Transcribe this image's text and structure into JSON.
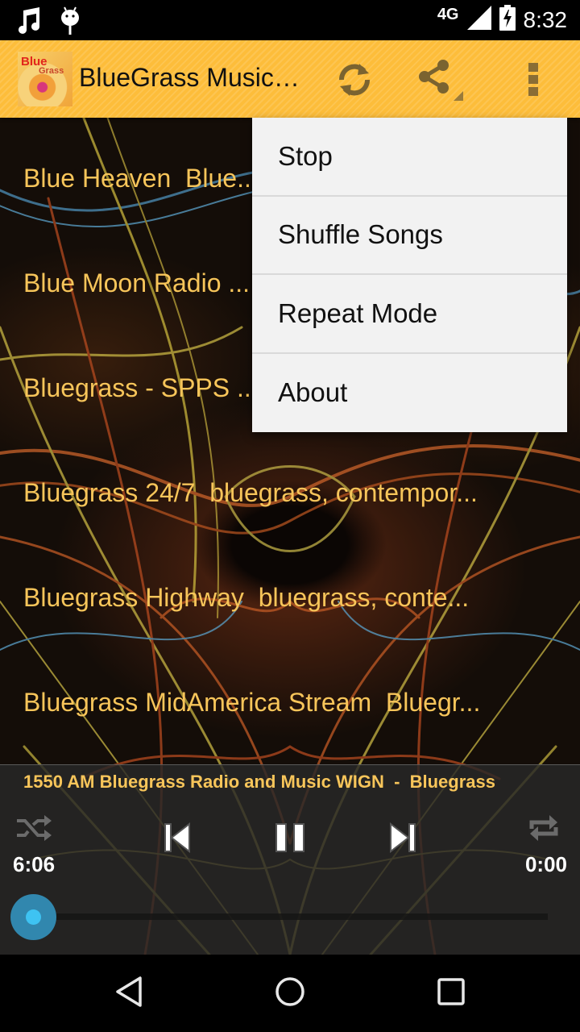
{
  "status_bar": {
    "left_icons": [
      "music-note-icon",
      "android-debug-icon"
    ],
    "network": "4G",
    "signal_icon": "cell-signal-icon",
    "battery_icon": "battery-charging-icon",
    "time": "8:32"
  },
  "action_bar": {
    "app_title": "BlueGrass Music Radio",
    "logo_text_1": "Blue",
    "logo_text_2": "Grass",
    "actions": [
      {
        "name": "refresh",
        "icon": "refresh-icon"
      },
      {
        "name": "share",
        "icon": "share-icon"
      },
      {
        "name": "more",
        "icon": "more-vert-icon"
      }
    ]
  },
  "stations": [
    {
      "label": "Blue Heaven  Blue..."
    },
    {
      "label": "Blue Moon Radio ..."
    },
    {
      "label": "Bluegrass - SPPS ..."
    },
    {
      "label": "Bluegrass 24/7  bluegrass, contempor..."
    },
    {
      "label": "Bluegrass Highway  bluegrass, conte..."
    },
    {
      "label": "Bluegrass MidAmerica Stream  Bluegr..."
    }
  ],
  "overflow_menu": {
    "items": [
      {
        "label": "Stop"
      },
      {
        "label": "Shuffle Songs"
      },
      {
        "label": "Repeat Mode"
      },
      {
        "label": "About"
      }
    ]
  },
  "player": {
    "now_playing": "1550 AM Bluegrass Radio and Music WIGN  -  Bluegrass",
    "elapsed": "6:06",
    "duration": "0:00",
    "progress_fraction": 0.0,
    "controls": [
      "shuffle-icon",
      "previous-icon",
      "pause-icon",
      "next-icon",
      "repeat-icon"
    ],
    "accent_color": "#3ec3f2"
  },
  "nav_bar": {
    "buttons": [
      "back-icon",
      "home-icon",
      "recents-icon"
    ]
  },
  "colors": {
    "action_bar": "#fdbd3a",
    "station_text": "#f7c55a",
    "menu_bg": "#f2f2f2"
  }
}
